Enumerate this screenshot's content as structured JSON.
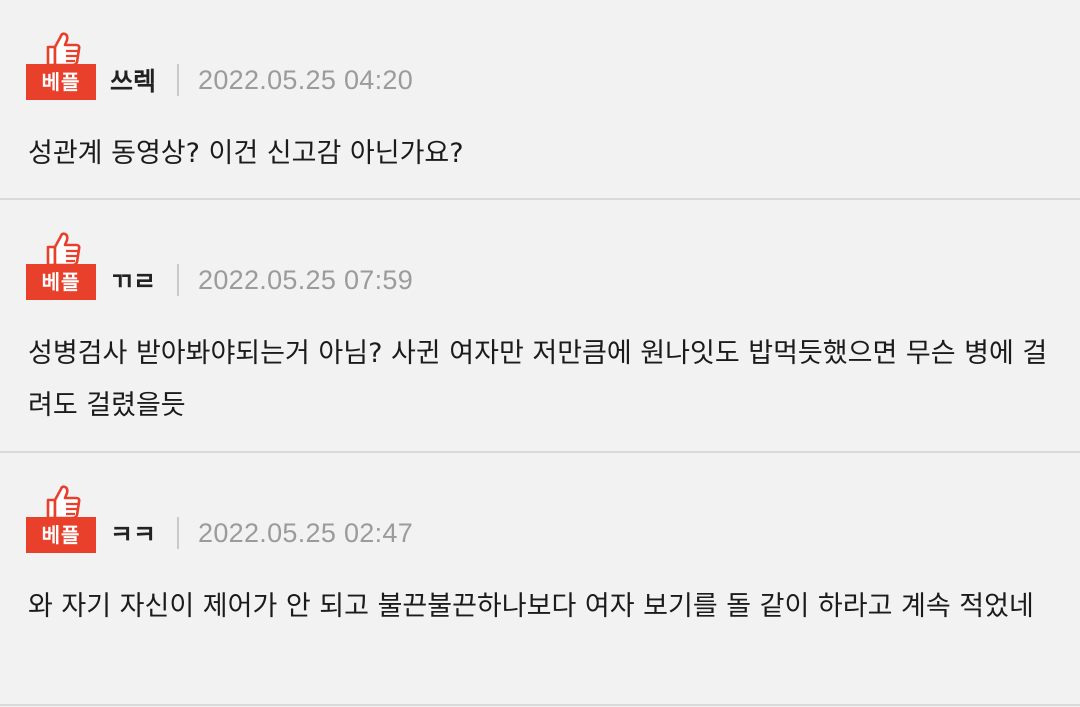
{
  "comments": [
    {
      "badge": "베플",
      "author": "쓰렉",
      "date": "2022.05.25 04:20",
      "text": "성관계 동영상? 이건 신고감 아닌가요?"
    },
    {
      "badge": "베플",
      "author": "ㄲㄹ",
      "date": "2022.05.25 07:59",
      "text": "성병검사 받아봐야되는거 아님? 사귄 여자만 저만큼에 원나잇도 밥먹듯했으면 무슨 병에 걸려도 걸렸을듯"
    },
    {
      "badge": "베플",
      "author": "ㅋㅋ",
      "date": "2022.05.25 02:47",
      "text": "와 자기 자신이 제어가 안 되고 불끈불끈하나보다 여자 보기를 돌 같이 하라고 계속 적었네"
    }
  ],
  "colors": {
    "badge_red": "#e8402a",
    "background": "#f2f2f2",
    "divider": "#d9d9d9",
    "date_gray": "#9b9b9b"
  },
  "icons": {
    "badge": "thumbs-up-icon"
  }
}
